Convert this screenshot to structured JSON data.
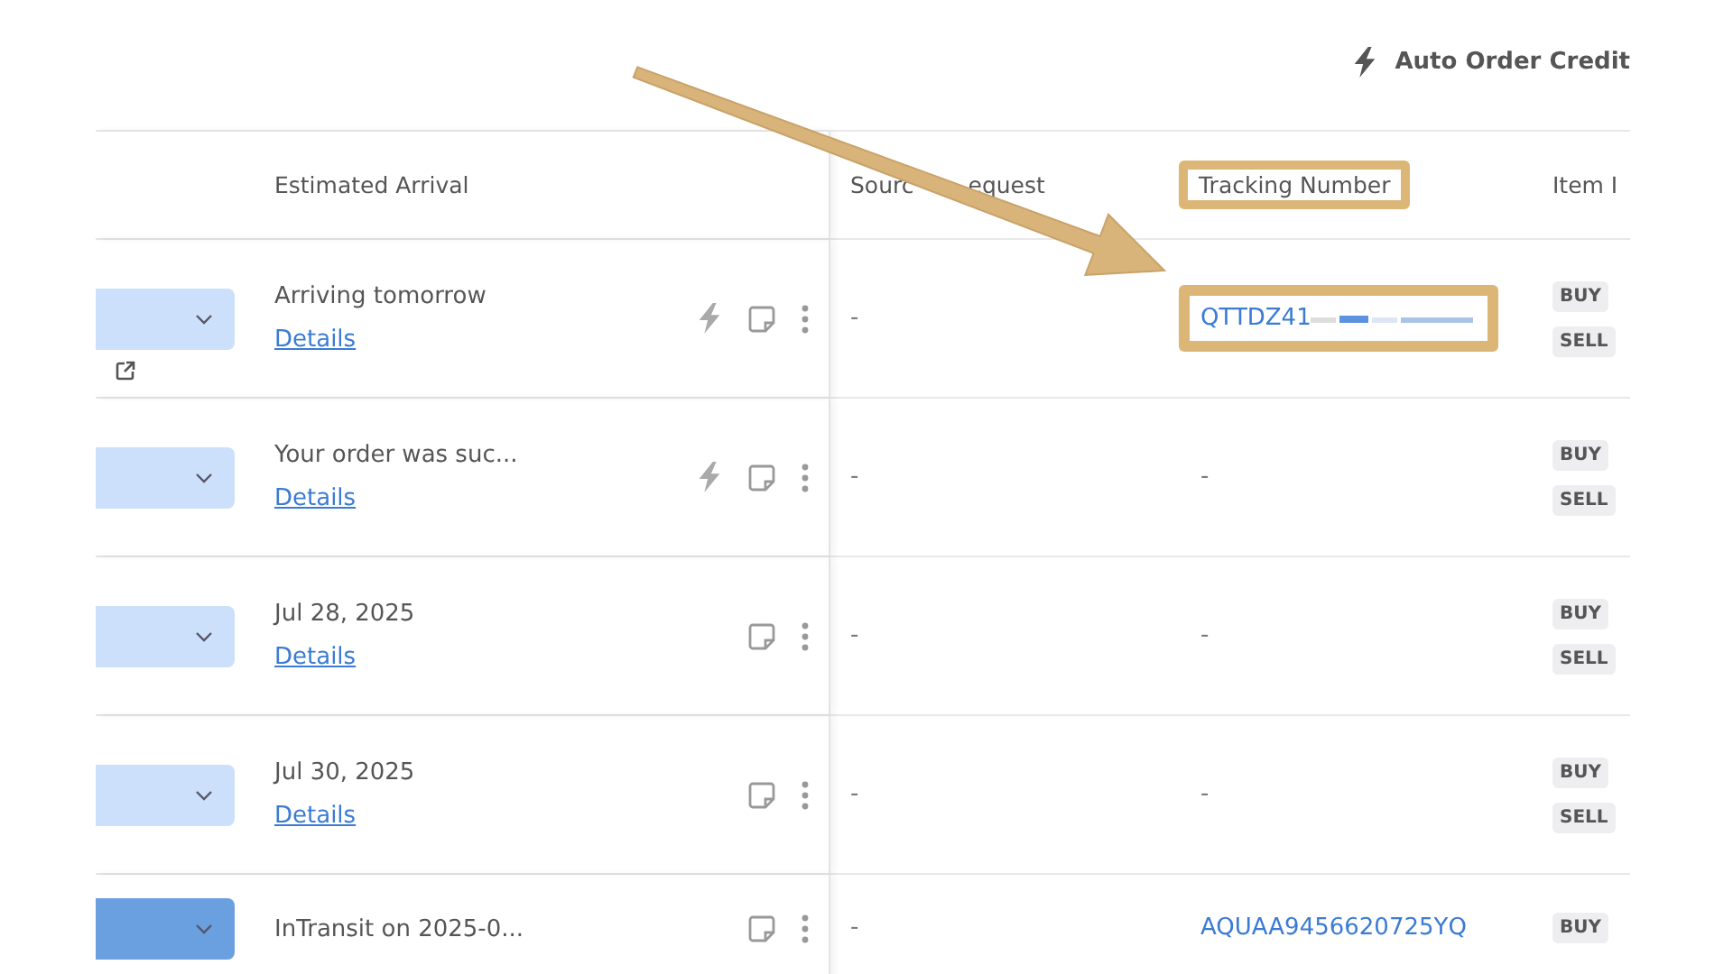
{
  "toolbar": {
    "credits_label": "Auto Order Credit"
  },
  "table": {
    "columns": [
      {
        "label": "Estimated Arrival",
        "highlighted": false
      },
      {
        "label_parts": [
          "Sourc",
          "equest"
        ],
        "highlighted": false
      },
      {
        "label": "Tracking Number",
        "highlighted": true
      },
      {
        "label": "Item I",
        "highlighted": false
      }
    ],
    "rows": [
      {
        "status_highlighted": false,
        "external_link": true,
        "arrival": "Arriving tomorrow",
        "details": "Details",
        "auto_order": true,
        "sourcing": "-",
        "tracking": "QTTDZ41",
        "tracking_redacted": true,
        "tracking_highlighted": true,
        "buy": "BUY",
        "sell": "SELL"
      },
      {
        "status_highlighted": false,
        "external_link": false,
        "arrival": "Your order was suc...",
        "details": "Details",
        "auto_order": true,
        "sourcing": "-",
        "tracking": "-",
        "tracking_redacted": false,
        "tracking_highlighted": false,
        "buy": "BUY",
        "sell": "SELL"
      },
      {
        "status_highlighted": false,
        "external_link": false,
        "arrival": "Jul 28, 2025",
        "details": "Details",
        "auto_order": false,
        "sourcing": "-",
        "tracking": "-",
        "tracking_redacted": false,
        "tracking_highlighted": false,
        "buy": "BUY",
        "sell": "SELL"
      },
      {
        "status_highlighted": false,
        "external_link": false,
        "arrival": "Jul 30, 2025",
        "details": "Details",
        "auto_order": false,
        "sourcing": "-",
        "tracking": "-",
        "tracking_redacted": false,
        "tracking_highlighted": false,
        "buy": "BUY",
        "sell": "SELL"
      },
      {
        "status_highlighted": true,
        "external_link": false,
        "arrival": "InTransit on 2025-0...",
        "auto_order": false,
        "sourcing": "-",
        "tracking": "AQUAA9456620725YQ",
        "tracking_redacted": false,
        "tracking_highlighted": false,
        "buy": "BUY"
      }
    ]
  }
}
